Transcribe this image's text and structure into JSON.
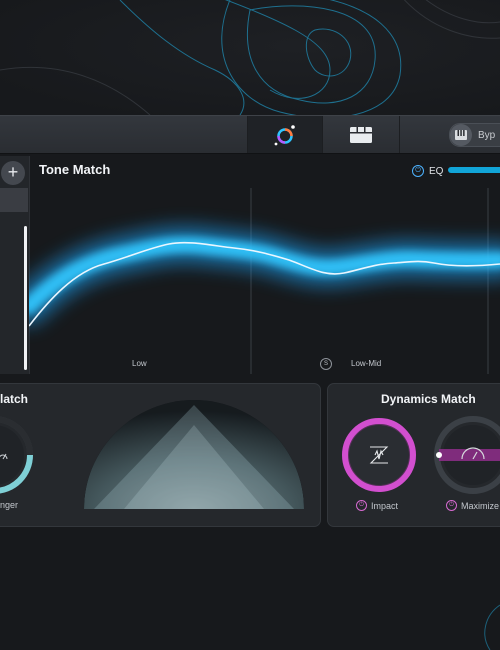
{
  "tabs": [
    {
      "icon": "color-orbit-icon",
      "active": true
    },
    {
      "icon": "blocks-icon",
      "active": false
    }
  ],
  "bypass": {
    "label": "Byp",
    "icon": "piano-keys-icon"
  },
  "left_panel": {
    "add_label": "+"
  },
  "tone_match": {
    "title": "Tone Match",
    "eq_label": "EQ",
    "bands": [
      "Low",
      "Low-Mid"
    ],
    "solo_label": "S"
  },
  "lower_left": {
    "title": "latch",
    "knob_label": "nger"
  },
  "dynamics_match": {
    "title": "Dynamics Match",
    "impact_label": "Impact",
    "maximizer_label": "Maximize"
  },
  "colors": {
    "accent_blue": "#2ec4ff",
    "accent_magenta": "#d24fcf",
    "background": "#17191c"
  }
}
